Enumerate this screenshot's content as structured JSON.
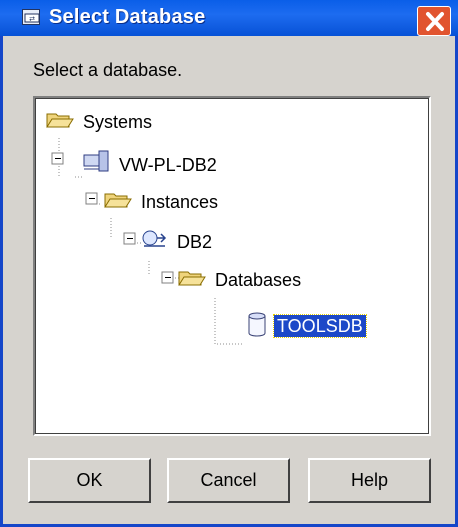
{
  "window": {
    "title": "Select Database",
    "close_icon": "close-icon",
    "app_icon": "db2-window-icon"
  },
  "prompt": "Select a database.",
  "tree": {
    "systems": "Systems",
    "host": "VW-PL-DB2",
    "instances": "Instances",
    "instance": "DB2",
    "databases": "Databases",
    "database": "TOOLSDB"
  },
  "buttons": {
    "ok": "OK",
    "cancel": "Cancel",
    "help": "Help"
  },
  "colors": {
    "title_blue": "#0a5ee8",
    "selection": "#1c48c8",
    "close_red": "#e1542f"
  }
}
